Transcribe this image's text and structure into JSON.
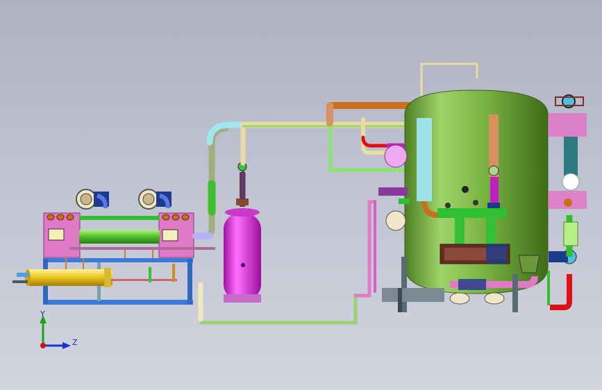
{
  "axis_triad": {
    "y_label": "Y",
    "z_label": "Z",
    "y_color": "#1aa31a",
    "z_color": "#1a2fd6",
    "origin_color": "#d01010"
  },
  "palette": {
    "vessel_green": "#6fae3a",
    "receiver_magenta": "#e020e0",
    "panel_pink": "#e07ac8",
    "pipe_orange": "#c8701e",
    "pipe_beige": "#e8dca0",
    "pipe_cyan": "#9fe6f0",
    "shell_yellow": "#f0d020",
    "frame_blue": "#3a7ad8"
  }
}
